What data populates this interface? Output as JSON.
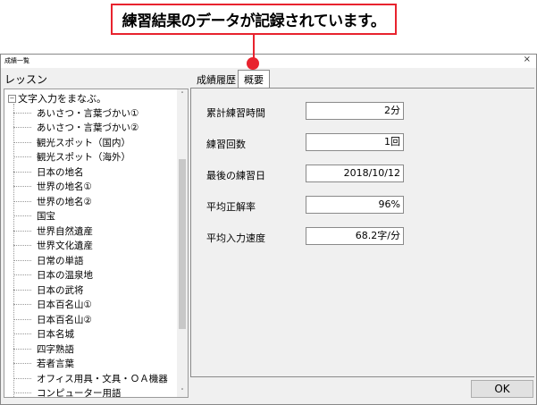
{
  "callout": {
    "text": "練習結果のデータが記録されています。"
  },
  "window": {
    "title": "成績一覧",
    "close": "×"
  },
  "lessons": {
    "label": "レッスン",
    "root": {
      "expander": "−",
      "label": "文字入力をまなぶ。"
    },
    "items": [
      "あいさつ・言葉づかい①",
      "あいさつ・言葉づかい②",
      "観光スポット（国内）",
      "観光スポット（海外）",
      "日本の地名",
      "世界の地名①",
      "世界の地名②",
      "国宝",
      "世界自然遺産",
      "世界文化遺産",
      "日常の単語",
      "日本の温泉地",
      "日本の武将",
      "日本百名山①",
      "日本百名山②",
      "日本名城",
      "四字熟語",
      "若者言葉",
      "オフィス用具・文具・ＯＡ機器",
      "コンピューター用語"
    ],
    "scrollbar": {
      "up": "˄",
      "down": "˅"
    }
  },
  "tabs": {
    "history": "成績履歴",
    "summary": "概要"
  },
  "stats": [
    {
      "label": "累計練習時間",
      "value": "2分"
    },
    {
      "label": "練習回数",
      "value": "1回"
    },
    {
      "label": "最後の練習日",
      "value": "2018/10/12"
    },
    {
      "label": "平均正解率",
      "value": "96%"
    },
    {
      "label": "平均入力速度",
      "value": "68.2字/分"
    }
  ],
  "ok_button": "OK",
  "colors": {
    "accent": "#e8232e"
  }
}
